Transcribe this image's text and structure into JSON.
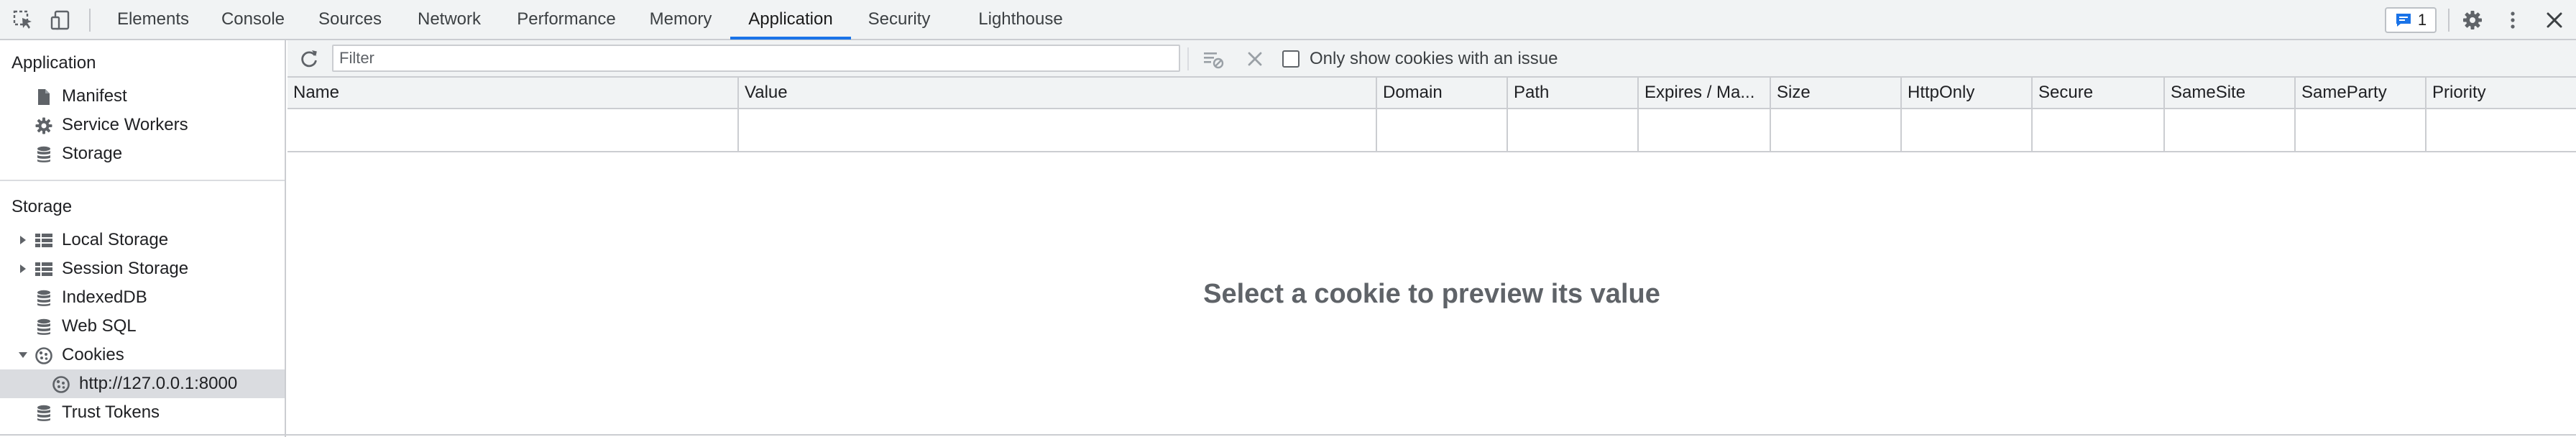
{
  "devtools": {
    "tabs": [
      {
        "label": "Elements"
      },
      {
        "label": "Console"
      },
      {
        "label": "Sources"
      },
      {
        "label": "Network"
      },
      {
        "label": "Performance"
      },
      {
        "label": "Memory"
      },
      {
        "label": "Application",
        "active": true
      },
      {
        "label": "Security"
      },
      {
        "label": "Lighthouse"
      }
    ],
    "issues_count": "1"
  },
  "sidebar": {
    "application_heading": "Application",
    "application_items": [
      {
        "label": "Manifest",
        "icon": "file-icon"
      },
      {
        "label": "Service Workers",
        "icon": "gear-icon"
      },
      {
        "label": "Storage",
        "icon": "database-icon"
      }
    ],
    "storage_heading": "Storage",
    "storage_items": [
      {
        "label": "Local Storage",
        "icon": "grid-icon",
        "expandable": true,
        "expanded": false
      },
      {
        "label": "Session Storage",
        "icon": "grid-icon",
        "expandable": true,
        "expanded": false
      },
      {
        "label": "IndexedDB",
        "icon": "database-icon"
      },
      {
        "label": "Web SQL",
        "icon": "database-icon"
      },
      {
        "label": "Cookies",
        "icon": "cookie-icon",
        "expandable": true,
        "expanded": true
      },
      {
        "label": "http://127.0.0.1:8000",
        "icon": "cookie-icon",
        "selected": true
      },
      {
        "label": "Trust Tokens",
        "icon": "database-icon"
      }
    ]
  },
  "toolbar": {
    "filter_placeholder": "Filter",
    "filter_value": "",
    "only_issues_label": "Only show cookies with an issue",
    "only_issues_checked": false
  },
  "table": {
    "columns": [
      "Name",
      "Value",
      "Domain",
      "Path",
      "Expires / Ma...",
      "Size",
      "HttpOnly",
      "Secure",
      "SameSite",
      "SameParty",
      "Priority"
    ],
    "rows": []
  },
  "preview": {
    "message": "Select a cookie to preview its value"
  },
  "colors": {
    "accent": "#1a73e8",
    "toolbar_bg": "#f1f3f4",
    "border": "#cbcdd1",
    "selected_bg": "#dadce0",
    "muted_text": "#5f6368"
  }
}
